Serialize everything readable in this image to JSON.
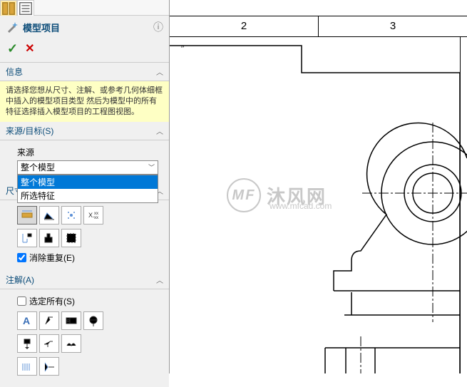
{
  "title": "模型项目",
  "info_head": "信息",
  "info_text": "请选择您想从尺寸、注解、或参考几何体细框中插入的模型项目类型    然后为模型中的所有特征选择插入模型项目的工程图视图。",
  "source": {
    "head": "来源/目标(S)",
    "label": "来源",
    "selected": "整个模型",
    "options": [
      "整个模型",
      "所选特征"
    ]
  },
  "dims": {
    "head": "尺寸(D)",
    "elim": "消除重复(E)"
  },
  "annot": {
    "head": "注解(A)",
    "selall": "选定所有(S)"
  },
  "ruler": [
    "2",
    "3"
  ],
  "watermark": {
    "logo": "MF",
    "text": "沐风网",
    "url": "www.mfcad.com"
  },
  "quote": "”"
}
